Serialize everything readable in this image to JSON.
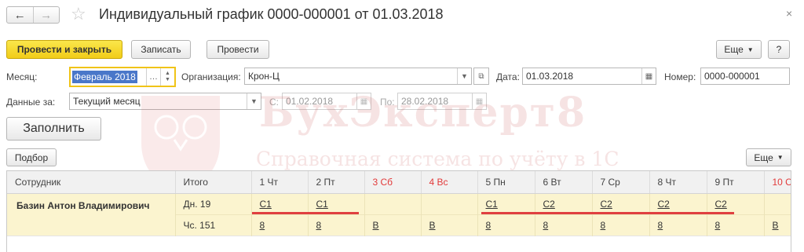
{
  "window": {
    "title": "Индивидуальный график 0000-000001 от 01.03.2018",
    "back_icon": "←",
    "forward_icon": "→",
    "star_icon": "☆",
    "close_icon": "×"
  },
  "toolbar": {
    "post_close": "Провести и закрыть",
    "save": "Записать",
    "post": "Провести",
    "more": "Еще",
    "help": "?"
  },
  "form": {
    "month_label": "Месяц:",
    "month_value": "Февраль 2018",
    "org_label": "Организация:",
    "org_value": "Крон-Ц",
    "date_label": "Дата:",
    "date_value": "01.03.2018",
    "number_label": "Номер:",
    "number_value": "0000-000001",
    "data_for_label": "Данные за:",
    "data_for_value": "Текущий месяц",
    "from_label": "С:",
    "from_value": "01.02.2018",
    "to_label": "По:",
    "to_value": "28.02.2018"
  },
  "fill_button": "Заполнить",
  "table_toolbar": {
    "pick": "Подбор",
    "more": "Еще"
  },
  "watermark": {
    "brand": "БухЭксперт8",
    "tagline": "Справочная система по учёту в 1С"
  },
  "table": {
    "columns": {
      "employee": "Сотрудник",
      "total": "Итого",
      "d1": "1 Чт",
      "d2": "2 Пт",
      "d3": "3 Сб",
      "d4": "4 Вс",
      "d5": "5 Пн",
      "d6": "6 Вт",
      "d7": "7 Ср",
      "d8": "8 Чт",
      "d9": "9 Пт",
      "d10": "10 С"
    },
    "employee_name": "Базин Антон Владимирович",
    "row_days": {
      "total": "Дн. 19",
      "d1": "С1",
      "d2": "С1",
      "d3": "",
      "d4": "",
      "d5": "С1",
      "d6": "С2",
      "d7": "С2",
      "d8": "С2",
      "d9": "С2",
      "d10": ""
    },
    "row_hours": {
      "total": "Чс. 151",
      "d1": "8",
      "d2": "8",
      "d3": "В",
      "d4": "В",
      "d5": "8",
      "d6": "8",
      "d7": "8",
      "d8": "8",
      "d9": "8",
      "d10": "В"
    }
  },
  "colors": {
    "primary_button": "#f5d21f",
    "weekend_header": "#e23a3a",
    "row_highlight": "#fbf4cf",
    "annotation_line": "#e04040"
  }
}
